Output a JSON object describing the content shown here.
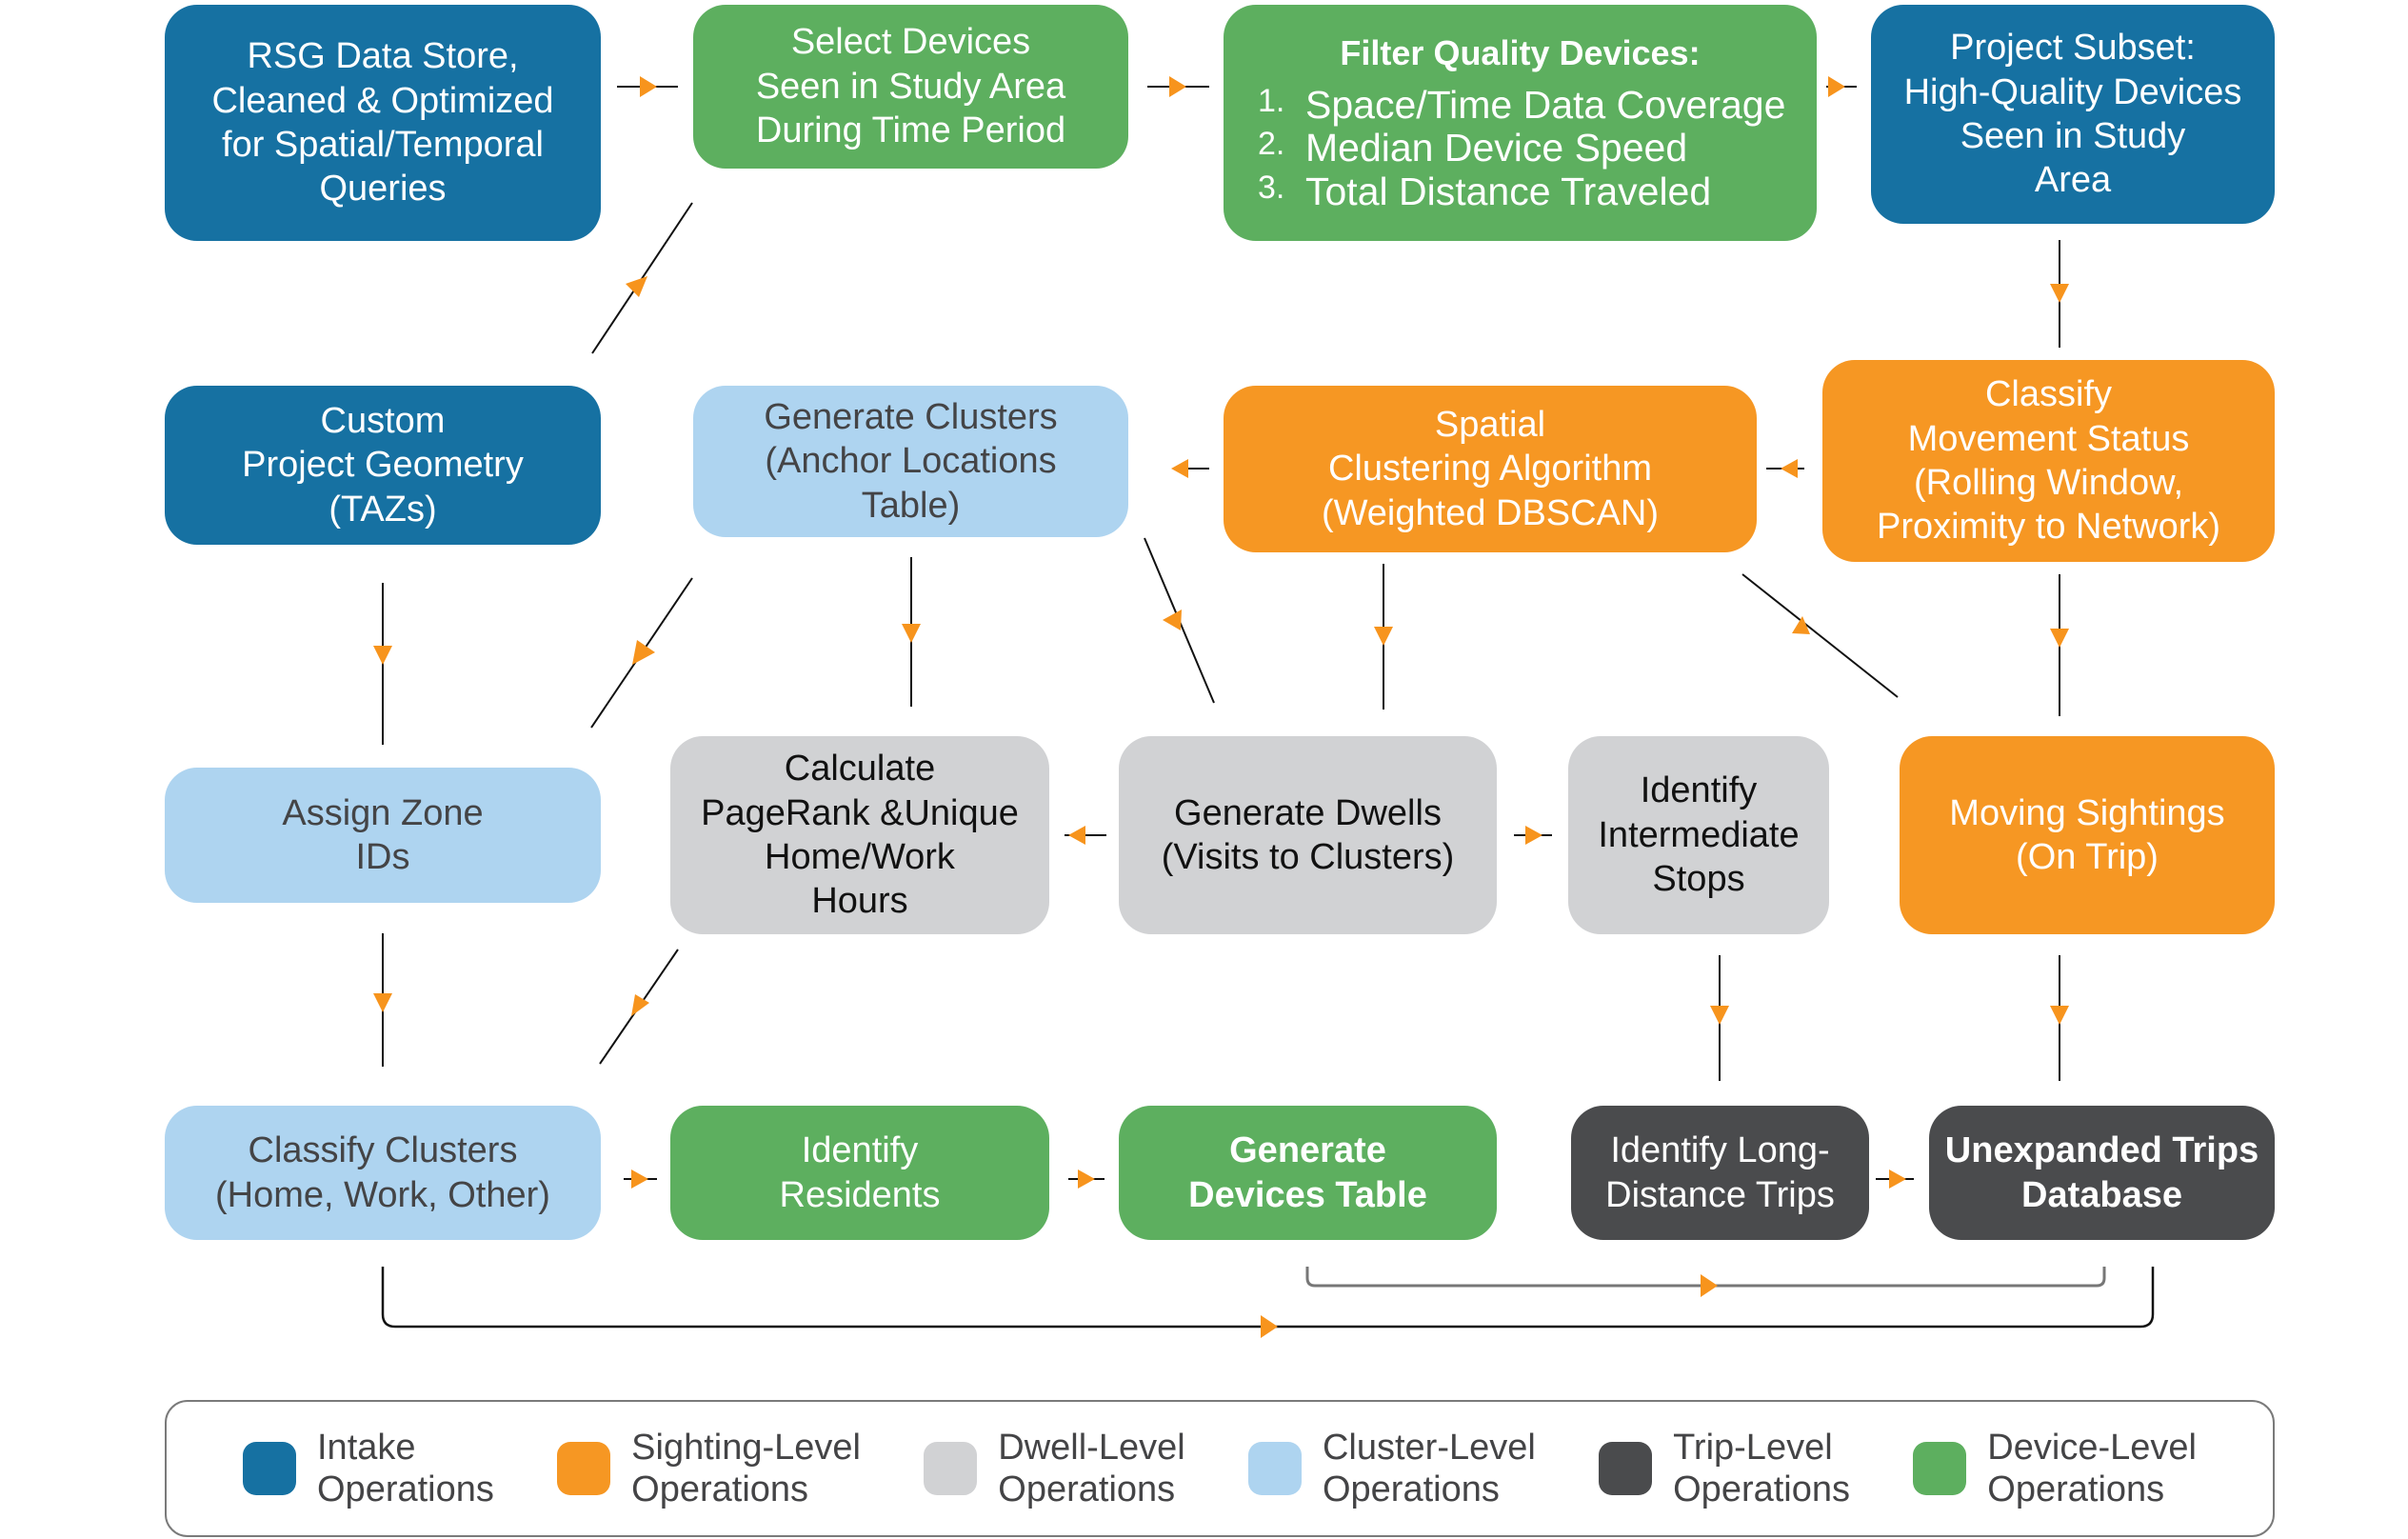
{
  "colors": {
    "intake": "#1671a2",
    "sighting": "#f69723",
    "dwell": "#d1d2d4",
    "cluster": "#aed4f0",
    "trip": "#4a4b4d",
    "device": "#5daf5f",
    "arrow": "#f7941d",
    "connector": "#111111"
  },
  "nodes": {
    "rsg_data_store": {
      "lines": [
        "RSG Data Store,",
        "Cleaned & Optimized",
        "for Spatial/Temporal",
        "Queries"
      ],
      "category": "intake"
    },
    "select_devices": {
      "lines": [
        "Select Devices",
        "Seen in Study Area",
        "During Time Period"
      ],
      "category": "device"
    },
    "filter_quality": {
      "title": "Filter Quality Devices:",
      "items": [
        {
          "num": "1.",
          "text": "Space/Time Data Coverage"
        },
        {
          "num": "2.",
          "text": "Median Device Speed"
        },
        {
          "num": "3.",
          "text": "Total Distance Traveled"
        }
      ],
      "category": "device"
    },
    "project_subset": {
      "lines": [
        "Project Subset:",
        "High-Quality Devices",
        "Seen in Study",
        "Area"
      ],
      "category": "intake"
    },
    "custom_geometry": {
      "lines": [
        "Custom",
        "Project Geometry",
        "(TAZs)"
      ],
      "category": "intake"
    },
    "generate_clusters": {
      "lines": [
        "Generate Clusters",
        "(Anchor Locations",
        "Table)"
      ],
      "category": "cluster"
    },
    "spatial_clustering": {
      "lines": [
        "Spatial",
        "Clustering Algorithm",
        "(Weighted DBSCAN)"
      ],
      "category": "sighting"
    },
    "classify_movement": {
      "lines": [
        "Classify",
        "Movement Status",
        "(Rolling Window,",
        "Proximity to Network)"
      ],
      "category": "sighting"
    },
    "assign_zone": {
      "lines": [
        "Assign Zone",
        "IDs"
      ],
      "category": "cluster"
    },
    "calculate_pagerank": {
      "lines": [
        "Calculate",
        "PageRank &Unique",
        "Home/Work",
        "Hours"
      ],
      "category": "dwell"
    },
    "generate_dwells": {
      "lines": [
        "Generate Dwells",
        "(Visits to Clusters)"
      ],
      "category": "dwell"
    },
    "identify_stops": {
      "lines": [
        "Identify",
        "Intermediate",
        "Stops"
      ],
      "category": "dwell"
    },
    "moving_sightings": {
      "lines": [
        "Moving Sightings",
        "(On Trip)"
      ],
      "category": "sighting"
    },
    "classify_clusters": {
      "lines": [
        "Classify Clusters",
        "(Home, Work, Other)"
      ],
      "category": "cluster"
    },
    "identify_residents": {
      "lines": [
        "Identify",
        "Residents"
      ],
      "category": "device"
    },
    "generate_devices_table": {
      "lines": [
        "Generate",
        "Devices Table"
      ],
      "category": "device"
    },
    "long_distance": {
      "lines": [
        "Identify Long-",
        "Distance Trips"
      ],
      "category": "trip"
    },
    "unexpanded_trips": {
      "lines": [
        "Unexpanded Trips",
        "Database"
      ],
      "category": "trip"
    }
  },
  "legend": [
    {
      "key": "intake",
      "lines": [
        "Intake",
        "Operations"
      ]
    },
    {
      "key": "sighting",
      "lines": [
        "Sighting-Level",
        "Operations"
      ]
    },
    {
      "key": "dwell",
      "lines": [
        "Dwell-Level",
        "Operations"
      ]
    },
    {
      "key": "cluster",
      "lines": [
        "Cluster-Level",
        "Operations"
      ]
    },
    {
      "key": "trip",
      "lines": [
        "Trip-Level",
        "Operations"
      ]
    },
    {
      "key": "device",
      "lines": [
        "Device-Level",
        "Operations"
      ]
    }
  ]
}
